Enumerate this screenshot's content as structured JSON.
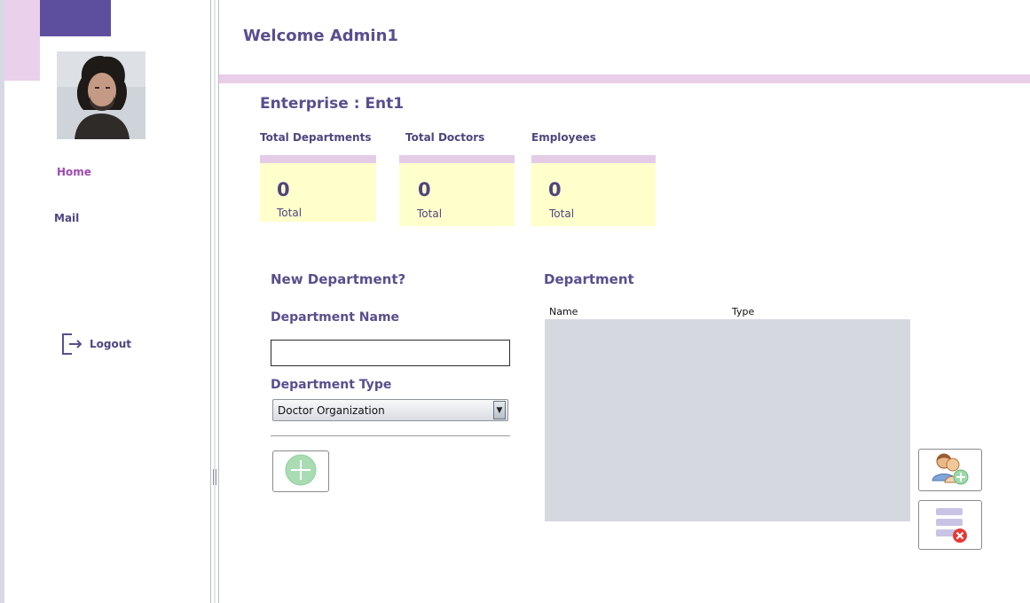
{
  "header": {
    "welcome": "Welcome Admin1"
  },
  "enterprise": {
    "label": "Enterprise : Ent1"
  },
  "sidebar": {
    "nav": [
      {
        "label": "Home"
      },
      {
        "label": "Mail"
      }
    ],
    "logout_label": "Logout"
  },
  "stats": [
    {
      "label": "Total Departments",
      "value": "0",
      "sub": "Total"
    },
    {
      "label": "Total Doctors",
      "value": "0",
      "sub": "Total"
    },
    {
      "label": "Employees",
      "value": "0",
      "sub": "Total"
    }
  ],
  "form": {
    "title": "New Department?",
    "name_label": "Department Name",
    "name_value": "",
    "type_label": "Department Type",
    "type_selected": "Doctor Organization"
  },
  "table": {
    "title": "Department",
    "columns": [
      "Name",
      "Type"
    ],
    "rows": []
  },
  "colors": {
    "brand_purple": "#5e4f9e",
    "accent_pink": "#e9cde9",
    "card_yellow": "#ffffcc",
    "home_active": "#a04ab4"
  },
  "icons": {
    "logout": "logout-icon",
    "add": "add-circle-icon",
    "assign": "add-user-icon",
    "delete": "delete-list-icon"
  }
}
